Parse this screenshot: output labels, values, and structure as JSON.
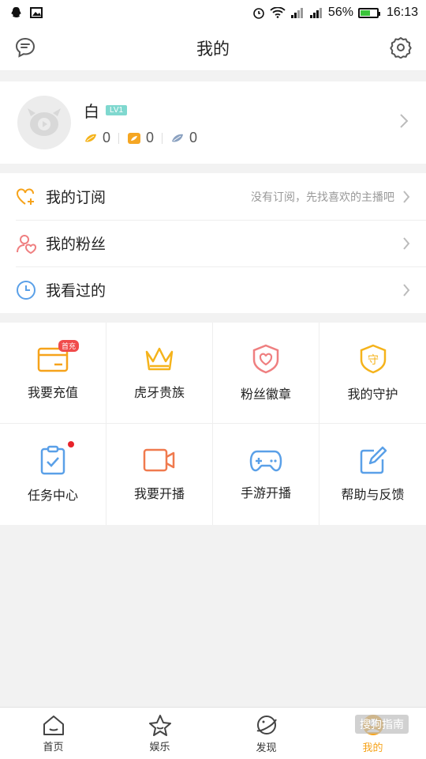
{
  "status_bar": {
    "battery": "56%",
    "time": "16:13"
  },
  "header": {
    "title": "我的",
    "left_icon": "message-icon",
    "right_icon": "gear-icon"
  },
  "profile": {
    "name": "白",
    "level": "LV1",
    "coins": [
      {
        "icon": "gold-bean-icon",
        "value": "0",
        "color": "#f5b31b"
      },
      {
        "icon": "gold-ticket-icon",
        "value": "0",
        "color": "#f5a623"
      },
      {
        "icon": "silver-bean-icon",
        "value": "0",
        "color": "#8aa1c0"
      }
    ]
  },
  "menu": [
    {
      "icon": "heart-plus-icon",
      "label": "我的订阅",
      "hint": "没有订阅，先找喜欢的主播吧"
    },
    {
      "icon": "user-heart-icon",
      "label": "我的粉丝",
      "hint": ""
    },
    {
      "icon": "clock-icon",
      "label": "我看过的",
      "hint": ""
    }
  ],
  "grid": [
    {
      "icon": "wallet-icon",
      "label": "我要充值",
      "badge": "首充"
    },
    {
      "icon": "crown-icon",
      "label": "虎牙贵族"
    },
    {
      "icon": "badge-heart-icon",
      "label": "粉丝徽章"
    },
    {
      "icon": "shield-guard-icon",
      "label": "我的守护",
      "glyph": "守"
    },
    {
      "icon": "clipboard-check-icon",
      "label": "任务中心",
      "dot": true
    },
    {
      "icon": "video-camera-icon",
      "label": "我要开播"
    },
    {
      "icon": "gamepad-icon",
      "label": "手游开播"
    },
    {
      "icon": "edit-icon",
      "label": "帮助与反馈"
    }
  ],
  "tabbar": [
    {
      "icon": "home-icon",
      "label": "首页"
    },
    {
      "icon": "star-icon",
      "label": "娱乐"
    },
    {
      "icon": "planet-icon",
      "label": "发现"
    },
    {
      "icon": "profile-icon",
      "label": "我的",
      "active": true
    }
  ],
  "watermark": "搜狗指南",
  "colors": {
    "accent": "#f6a31b",
    "level_badge": "#7fd8cf",
    "badge_red": "#f04b4b"
  }
}
